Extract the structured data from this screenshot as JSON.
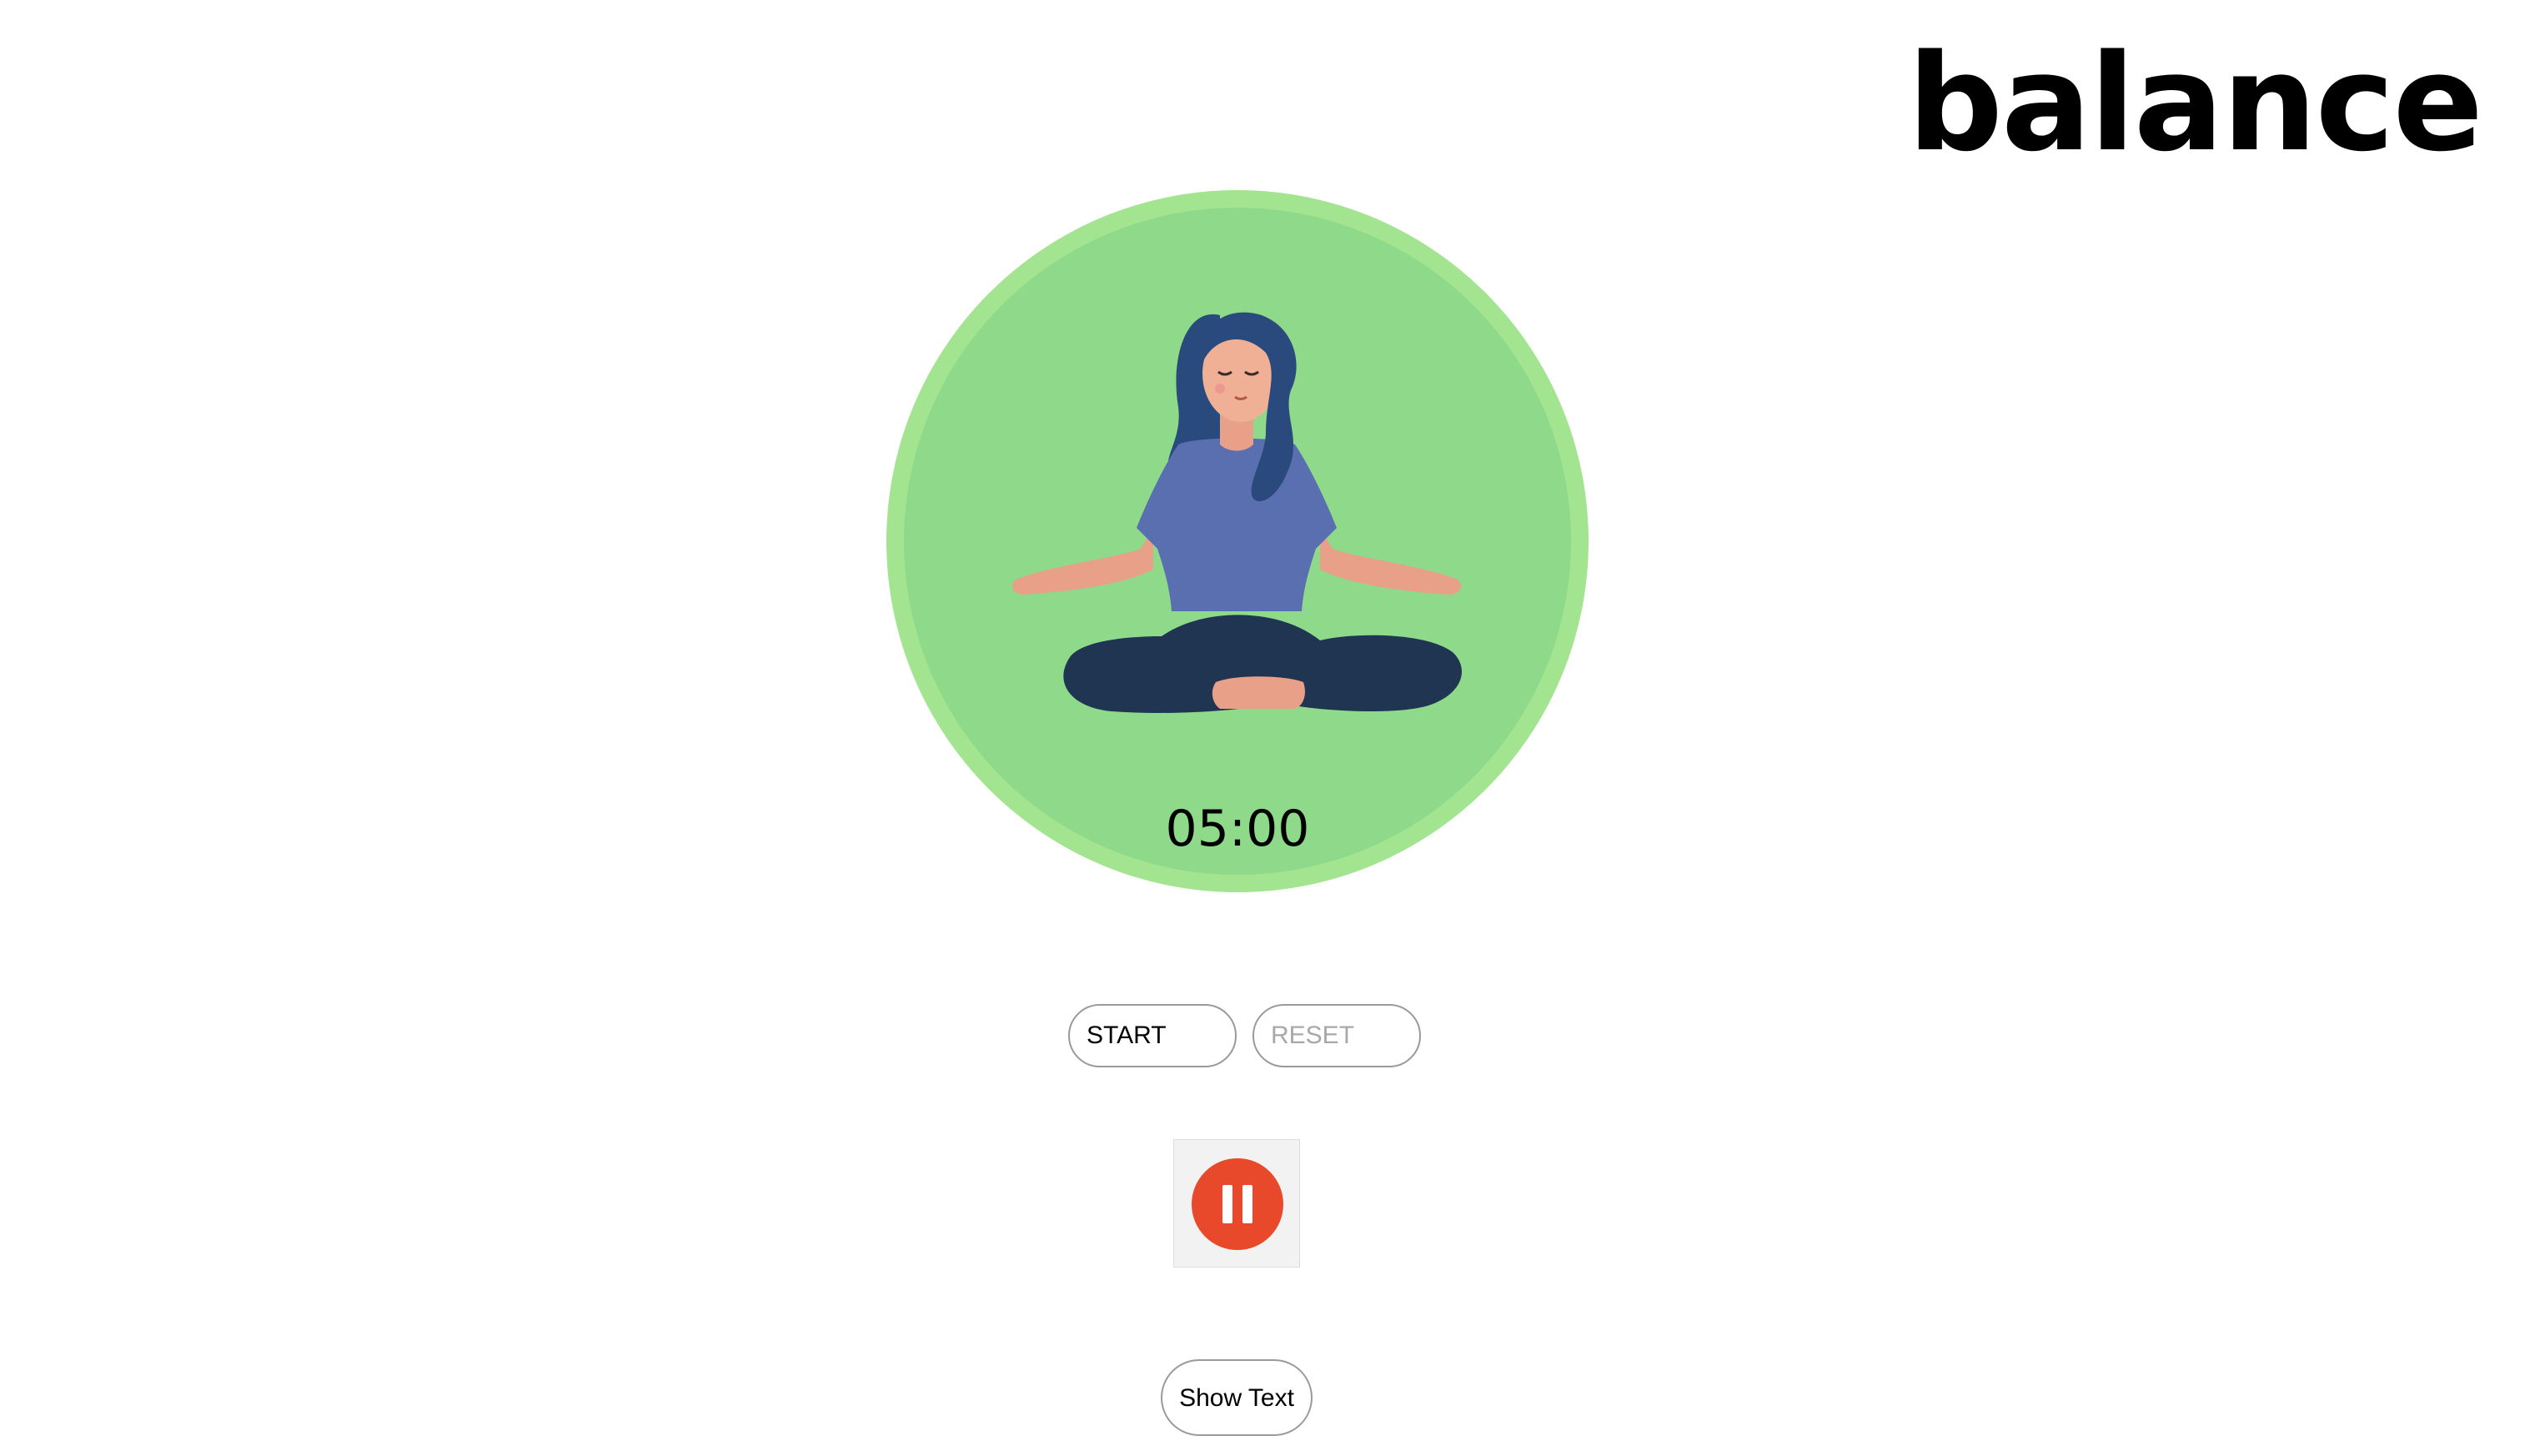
{
  "brand": {
    "title": "balance"
  },
  "timer": {
    "display": "05:00"
  },
  "controls": {
    "start_label": "START",
    "reset_label": "RESET",
    "show_text_label": "Show Text"
  },
  "icons": {
    "illustration": "meditating-woman-illustration",
    "pause": "pause-icon"
  },
  "colors": {
    "circle_outer": "#a3e490",
    "circle_inner": "#8ed98a",
    "pause_button": "#e8492a",
    "background": "#ffffff"
  }
}
